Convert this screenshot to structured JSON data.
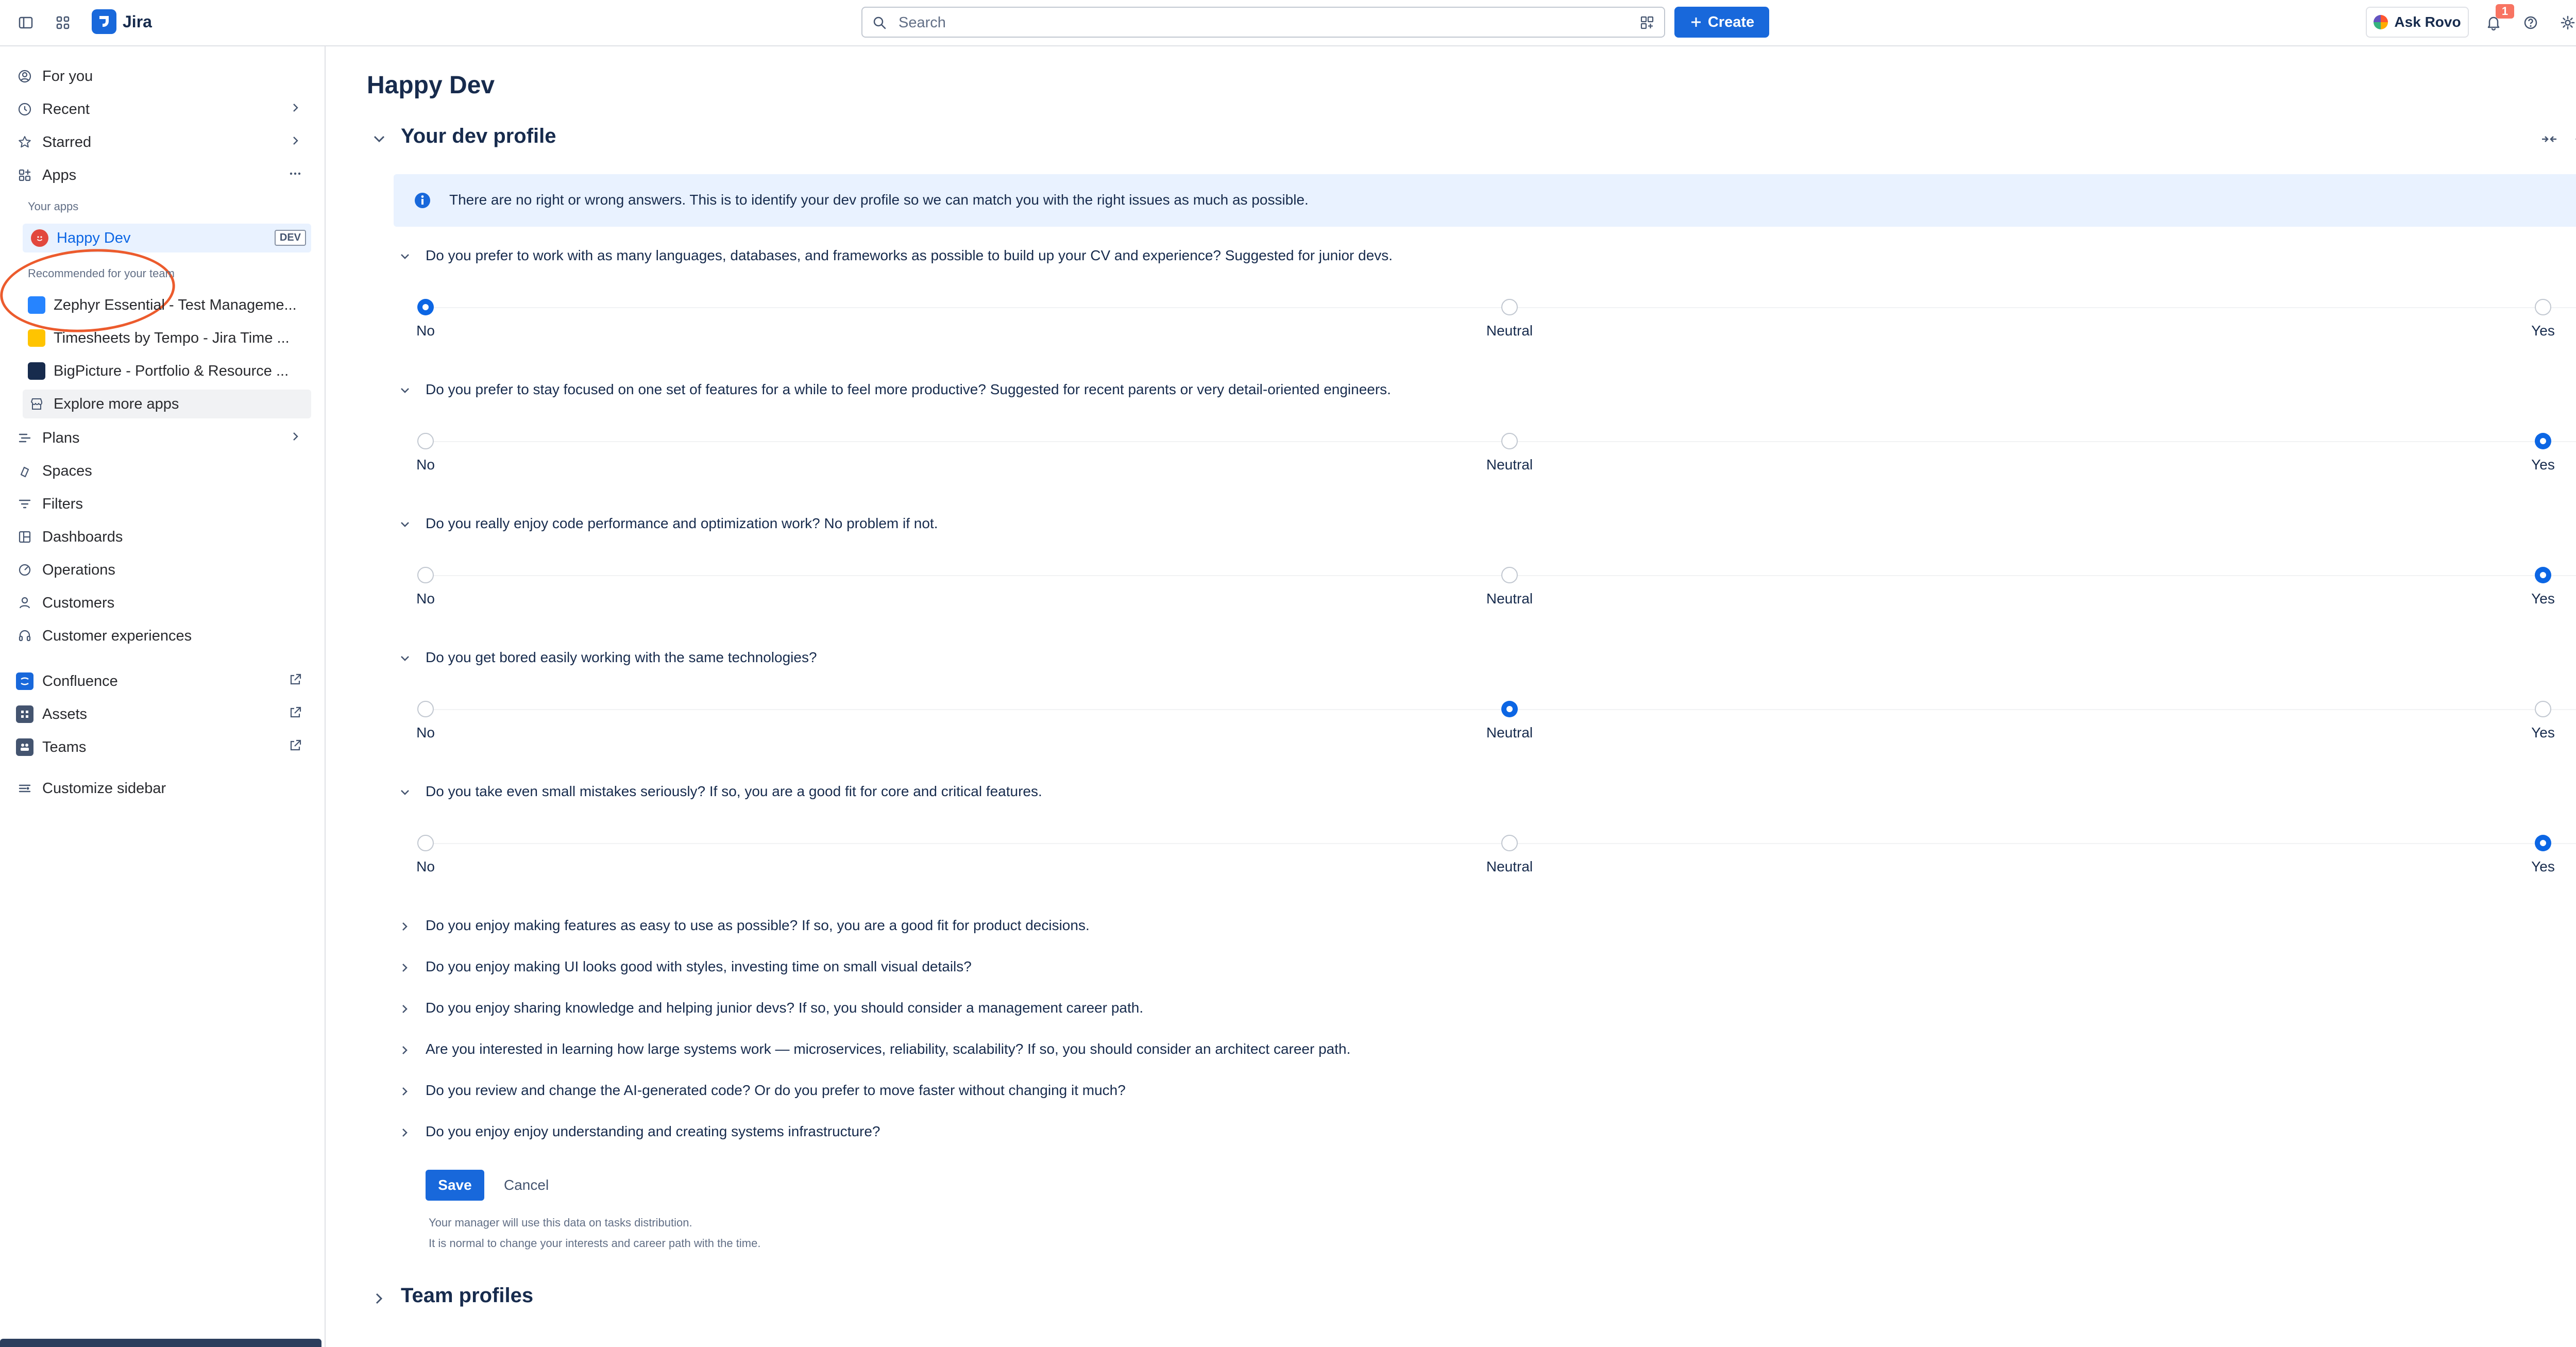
{
  "app": {
    "name": "Jira",
    "brand_color": "#1868db"
  },
  "topbar": {
    "search_placeholder": "Search",
    "create_label": "Create",
    "ask_rovo_label": "Ask Rovo",
    "notification_count": "1"
  },
  "sidebar": {
    "for_you": "For you",
    "recent": "Recent",
    "starred": "Starred",
    "apps": "Apps",
    "your_apps_label": "Your apps",
    "happy_dev": "Happy Dev",
    "happy_dev_badge": "DEV",
    "recommended_label": "Recommended for your team",
    "recommended": [
      {
        "label": "Zephyr Essential - Test Manageme...",
        "color": "#2684ff"
      },
      {
        "label": "Timesheets by Tempo - Jira Time ...",
        "color": "#ffc400"
      },
      {
        "label": "BigPicture - Portfolio & Resource ...",
        "color": "#172b4d"
      }
    ],
    "explore_more": "Explore more apps",
    "plans": "Plans",
    "spaces": "Spaces",
    "filters": "Filters",
    "dashboards": "Dashboards",
    "operations": "Operations",
    "customers": "Customers",
    "customer_experiences": "Customer experiences",
    "confluence": "Confluence",
    "assets": "Assets",
    "teams": "Teams",
    "customize": "Customize sidebar"
  },
  "main": {
    "page_title": "Happy Dev",
    "section_title": "Your dev profile",
    "info_text": "There are no right or wrong answers. This is to identify your dev profile so we can match you with the right issues as much as possible.",
    "scale_labels": {
      "no": "No",
      "neutral": "Neutral",
      "yes": "Yes"
    },
    "expanded_questions": [
      {
        "text": "Do you prefer to work with as many languages, databases, and frameworks as possible to build up your CV and experience? Suggested for junior devs.",
        "selected": "No"
      },
      {
        "text": "Do you prefer to stay focused on one set of features for a while to feel more productive? Suggested for recent parents or very detail-oriented engineers.",
        "selected": "Yes"
      },
      {
        "text": "Do you really enjoy code performance and optimization work? No problem if not.",
        "selected": "Yes"
      },
      {
        "text": "Do you get bored easily working with the same technologies?",
        "selected": "Neutral"
      },
      {
        "text": "Do you take even small mistakes seriously? If so, you are a good fit for core and critical features.",
        "selected": "Yes"
      }
    ],
    "collapsed_questions": [
      "Do you enjoy making features as easy to use as possible? If so, you are a good fit for product decisions.",
      "Do you enjoy making UI looks good with styles, investing time on small visual details?",
      "Do you enjoy sharing knowledge and helping junior devs? If so, you should consider a management career path.",
      "Are you interested in learning how large systems work — microservices, reliability, scalability? If so, you should consider an architect career path.",
      "Do you review and change the AI-generated code? Or do you prefer to move faster without changing it much?",
      "Do you enjoy enjoy understanding and creating systems infrastructure?"
    ],
    "save_label": "Save",
    "cancel_label": "Cancel",
    "note_1": "Your manager will use this data on tasks distribution.",
    "note_2": "It is normal to change your interests and career path with the time.",
    "team_profiles": "Team profiles"
  }
}
